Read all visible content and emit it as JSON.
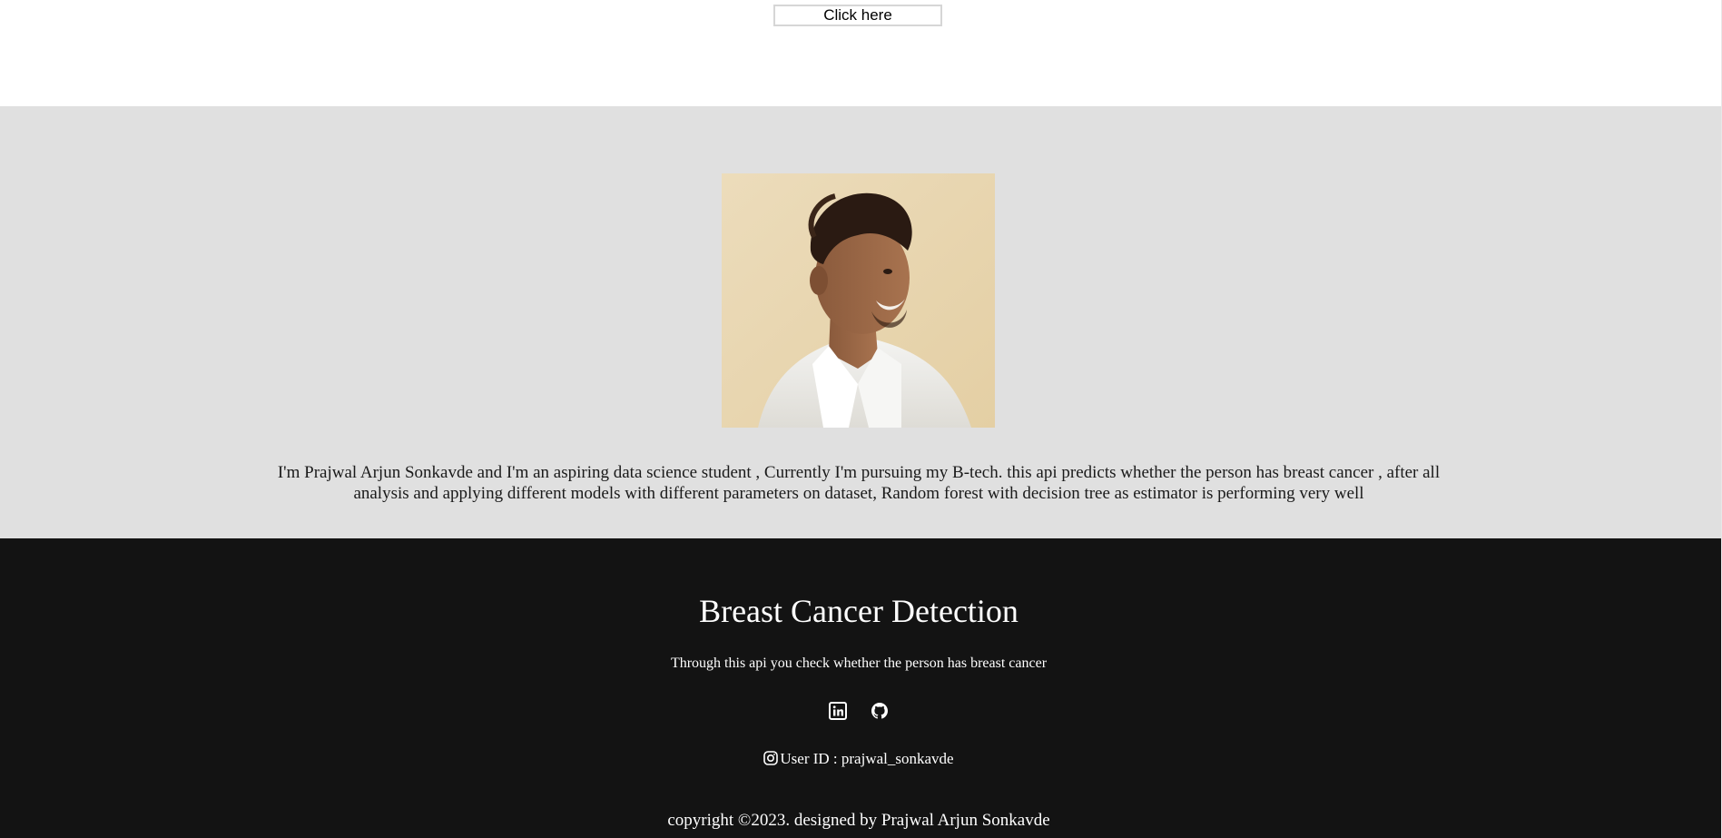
{
  "top": {
    "button_label": "Click here"
  },
  "about": {
    "photo_alt": "Prajwal Arjun Sonkavde",
    "text_line_1": "I'm Prajwal Arjun Sonkavde and I'm an aspiring data science student , Currently I'm pursuing my B-tech. this api predicts whether the person has breast cancer , after all",
    "text_line_2": "analysis and applying different models with different parameters on dataset, Random forest with decision tree as estimator is performing very well"
  },
  "footer": {
    "title": "Breast Cancer Detection",
    "subtitle": "Through this api you check whether the person has breast cancer",
    "social_icons": [
      "linkedin-icon",
      "github-icon"
    ],
    "instagram_icon": "instagram-icon",
    "user_id": "User ID : prajwal_sonkavde",
    "copyright": "copyright ©2023. designed by Prajwal Arjun Sonkavde"
  },
  "colors": {
    "about_background": "#e0e0e0",
    "footer_background": "#131313",
    "footer_text": "#ffffff"
  }
}
